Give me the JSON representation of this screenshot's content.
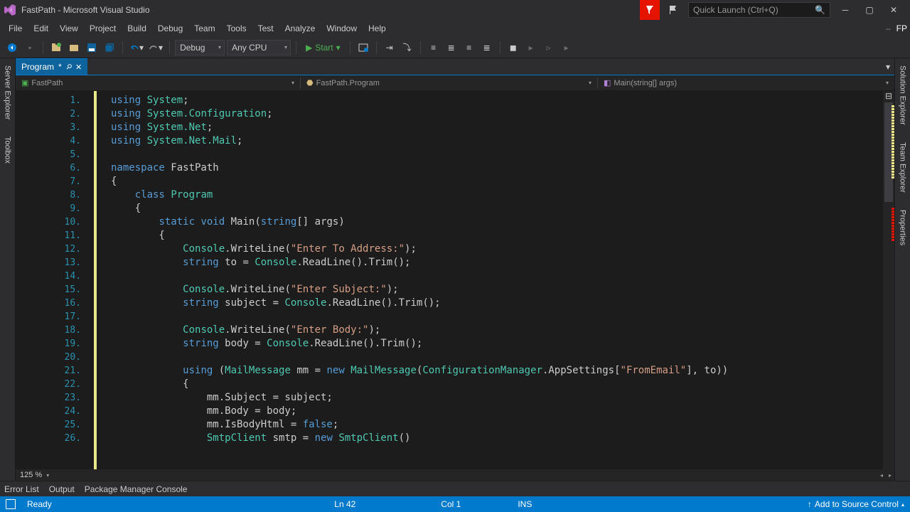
{
  "window": {
    "title": "FastPath - Microsoft Visual Studio",
    "quick_launch": "Quick Launch (Ctrl+Q)",
    "badge": "FP"
  },
  "menu": [
    "File",
    "Edit",
    "View",
    "Project",
    "Build",
    "Debug",
    "Team",
    "Tools",
    "Test",
    "Analyze",
    "Window",
    "Help"
  ],
  "toolbar": {
    "config": "Debug",
    "platform": "Any CPU",
    "start": "Start"
  },
  "doc_tab": {
    "name": "Program",
    "modified": "*"
  },
  "breadcrumb": {
    "project": "FastPath",
    "class": "FastPath.Program",
    "method": "Main(string[] args)"
  },
  "sidebar_left": [
    "Server Explorer",
    "Toolbox"
  ],
  "sidebar_right": [
    "Solution Explorer",
    "Team Explorer",
    "Properties"
  ],
  "code_lines": [
    [
      [
        "kw",
        "using"
      ],
      [
        "pn",
        " "
      ],
      [
        "type",
        "System"
      ],
      [
        "pn",
        ";"
      ]
    ],
    [
      [
        "kw",
        "using"
      ],
      [
        "pn",
        " "
      ],
      [
        "type",
        "System.Configuration"
      ],
      [
        "pn",
        ";"
      ]
    ],
    [
      [
        "kw",
        "using"
      ],
      [
        "pn",
        " "
      ],
      [
        "type",
        "System.Net"
      ],
      [
        "pn",
        ";"
      ]
    ],
    [
      [
        "kw",
        "using"
      ],
      [
        "pn",
        " "
      ],
      [
        "type",
        "System.Net.Mail"
      ],
      [
        "pn",
        ";"
      ]
    ],
    [],
    [
      [
        "kw",
        "namespace"
      ],
      [
        "pn",
        " FastPath"
      ]
    ],
    [
      [
        "pn",
        "{"
      ]
    ],
    [
      [
        "pn",
        "    "
      ],
      [
        "kw",
        "class"
      ],
      [
        "pn",
        " "
      ],
      [
        "cls",
        "Program"
      ]
    ],
    [
      [
        "pn",
        "    {"
      ]
    ],
    [
      [
        "pn",
        "        "
      ],
      [
        "kw",
        "static"
      ],
      [
        "pn",
        " "
      ],
      [
        "kw",
        "void"
      ],
      [
        "pn",
        " Main("
      ],
      [
        "kw",
        "string"
      ],
      [
        "pn",
        "[] args)"
      ]
    ],
    [
      [
        "pn",
        "        {"
      ]
    ],
    [
      [
        "pn",
        "            "
      ],
      [
        "cls",
        "Console"
      ],
      [
        "pn",
        ".WriteLine("
      ],
      [
        "str",
        "\"Enter To Address:\""
      ],
      [
        "pn",
        ");"
      ]
    ],
    [
      [
        "pn",
        "            "
      ],
      [
        "kw",
        "string"
      ],
      [
        "pn",
        " to = "
      ],
      [
        "cls",
        "Console"
      ],
      [
        "pn",
        ".ReadLine().Trim();"
      ]
    ],
    [],
    [
      [
        "pn",
        "            "
      ],
      [
        "cls",
        "Console"
      ],
      [
        "pn",
        ".WriteLine("
      ],
      [
        "str",
        "\"Enter Subject:\""
      ],
      [
        "pn",
        ");"
      ]
    ],
    [
      [
        "pn",
        "            "
      ],
      [
        "kw",
        "string"
      ],
      [
        "pn",
        " subject = "
      ],
      [
        "cls",
        "Console"
      ],
      [
        "pn",
        ".ReadLine().Trim();"
      ]
    ],
    [],
    [
      [
        "pn",
        "            "
      ],
      [
        "cls",
        "Console"
      ],
      [
        "pn",
        ".WriteLine("
      ],
      [
        "str",
        "\"Enter Body:\""
      ],
      [
        "pn",
        ");"
      ]
    ],
    [
      [
        "pn",
        "            "
      ],
      [
        "kw",
        "string"
      ],
      [
        "pn",
        " body = "
      ],
      [
        "cls",
        "Console"
      ],
      [
        "pn",
        ".ReadLine().Trim();"
      ]
    ],
    [],
    [
      [
        "pn",
        "            "
      ],
      [
        "kw",
        "using"
      ],
      [
        "pn",
        " ("
      ],
      [
        "cls",
        "MailMessage"
      ],
      [
        "pn",
        " mm = "
      ],
      [
        "kw",
        "new"
      ],
      [
        "pn",
        " "
      ],
      [
        "cls",
        "MailMessage"
      ],
      [
        "pn",
        "("
      ],
      [
        "cls",
        "ConfigurationManager"
      ],
      [
        "pn",
        ".AppSettings["
      ],
      [
        "str",
        "\"FromEmail\""
      ],
      [
        "pn",
        "], to))"
      ]
    ],
    [
      [
        "pn",
        "            {"
      ]
    ],
    [
      [
        "pn",
        "                mm.Subject = subject;"
      ]
    ],
    [
      [
        "pn",
        "                mm.Body = body;"
      ]
    ],
    [
      [
        "pn",
        "                mm.IsBodyHtml = "
      ],
      [
        "kw",
        "false"
      ],
      [
        "pn",
        ";"
      ]
    ],
    [
      [
        "pn",
        "                "
      ],
      [
        "cls",
        "SmtpClient"
      ],
      [
        "pn",
        " smtp = "
      ],
      [
        "kw",
        "new"
      ],
      [
        "pn",
        " "
      ],
      [
        "cls",
        "SmtpClient"
      ],
      [
        "pn",
        "()"
      ]
    ]
  ],
  "zoom": "125 %",
  "bottom_tabs": [
    "Error List",
    "Output",
    "Package Manager Console"
  ],
  "status": {
    "ready": "Ready",
    "ln": "Ln 42",
    "col": "Col 1",
    "ins": "INS",
    "src_ctrl": "Add to Source Control"
  }
}
